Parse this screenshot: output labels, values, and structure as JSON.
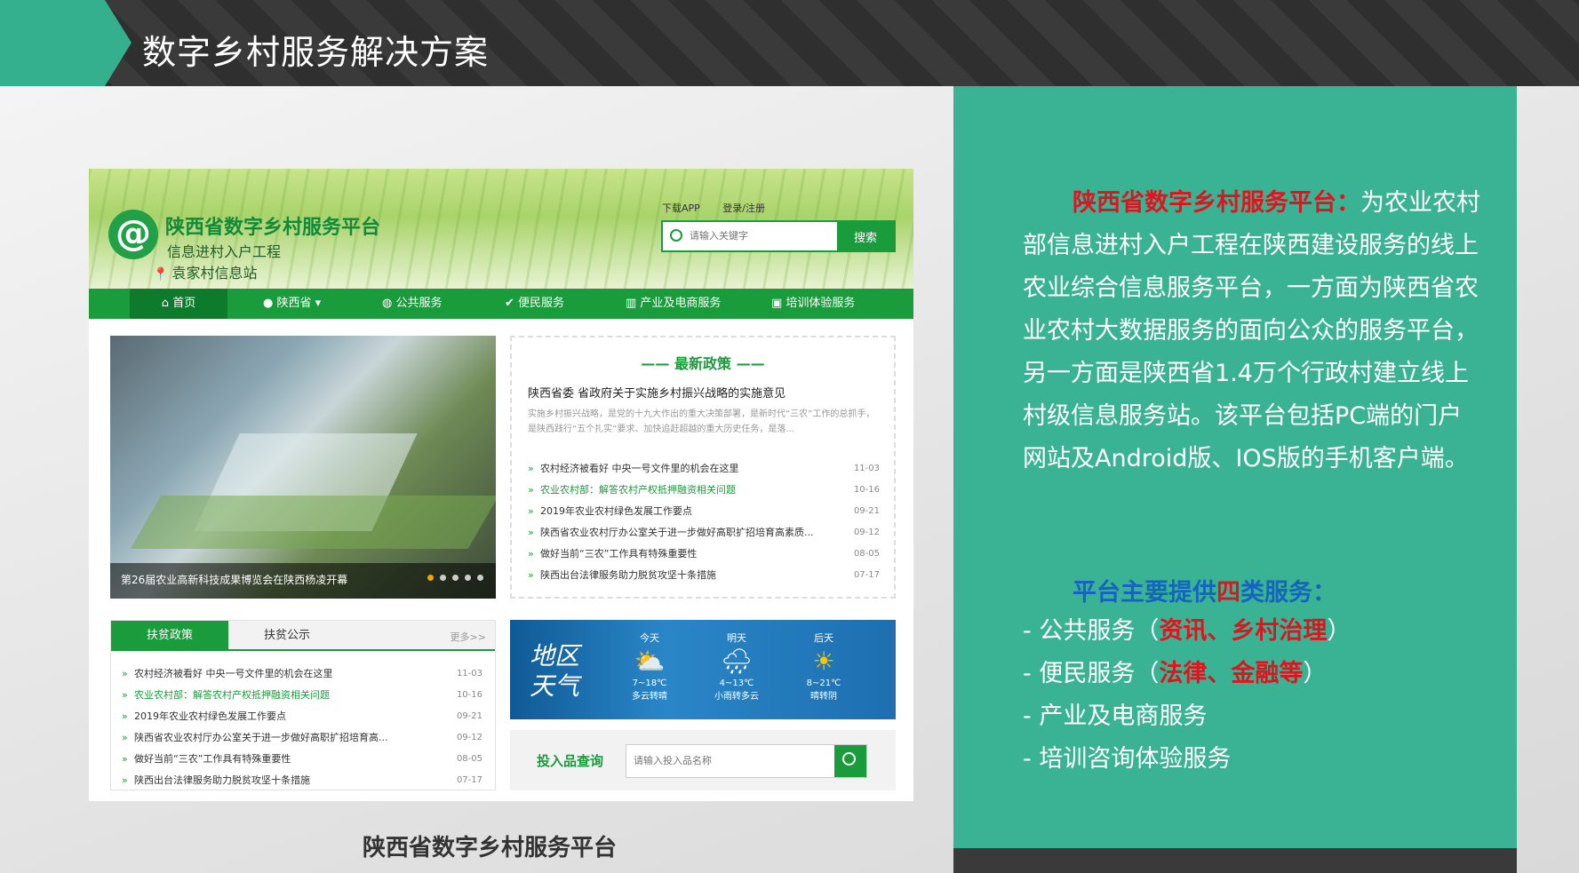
{
  "slide": {
    "title": "数字乡村服务解决方案",
    "screenshot_caption": "陕西省数字乡村服务平台"
  },
  "site": {
    "logo_glyph": "@",
    "name": "陕西省数字乡村服务平台",
    "subtitle": "信息进村入户工程",
    "station": "袁家村信息站",
    "top_links": {
      "download_app": "下载APP",
      "login": "登录/注册"
    },
    "search": {
      "placeholder": "请输入关键字",
      "button": "搜索"
    },
    "nav": [
      "首页",
      "陕西省",
      "公共服务",
      "便民服务",
      "产业及电商服务",
      "培训体验服务"
    ],
    "carousel": {
      "caption": "第26届农业高新科技成果博览会在陕西杨凌开幕",
      "slides": 5,
      "active_slide": 1
    },
    "policy": {
      "title": "最新政策",
      "headline": "陕西省委 省政府关于实施乡村振兴战略的实施意见",
      "summary": "实施乡村振兴战略，是党的十九大作出的重大决策部署，是新时代“三农”工作的总抓手，是陕西践行“五个扎实”要求、加快追赶超越的重大历史任务，是落...",
      "items": [
        {
          "title": "农村经济被看好 中央一号文件里的机会在这里",
          "date": "11-03",
          "highlight": false
        },
        {
          "title": "农业农村部：解答农村产权抵押融资相关问题",
          "date": "10-16",
          "highlight": true
        },
        {
          "title": "2019年农业农村绿色发展工作要点",
          "date": "09-21",
          "highlight": false
        },
        {
          "title": "陕西省农业农村厅办公室关于进一步做好高职扩招培育高素质...",
          "date": "09-12",
          "highlight": false
        },
        {
          "title": "做好当前“三农”工作具有特殊重要性",
          "date": "08-05",
          "highlight": false
        },
        {
          "title": "陕西出台法律服务助力脱贫攻坚十条措施",
          "date": "07-17",
          "highlight": false
        }
      ]
    },
    "poverty": {
      "tabs": [
        "扶贫政策",
        "扶贫公示"
      ],
      "more": "更多>>",
      "items": [
        {
          "title": "农村经济被看好 中央一号文件里的机会在这里",
          "date": "11-03",
          "highlight": false
        },
        {
          "title": "农业农村部：解答农村产权抵押融资相关问题",
          "date": "10-16",
          "highlight": true
        },
        {
          "title": "2019年农业农村绿色发展工作要点",
          "date": "09-21",
          "highlight": false
        },
        {
          "title": "陕西省农业农村厅办公室关于进一步做好高职扩招培育高...",
          "date": "09-12",
          "highlight": false
        },
        {
          "title": "做好当前“三农”工作具有特殊重要性",
          "date": "08-05",
          "highlight": false
        },
        {
          "title": "陕西出台法律服务助力脱贫攻坚十条措施",
          "date": "07-17",
          "highlight": false
        }
      ]
    },
    "weather": {
      "title": "地区天气",
      "days": [
        {
          "label": "今天",
          "icon": "⛅",
          "temp": "7~18℃",
          "desc": "多云转晴"
        },
        {
          "label": "明天",
          "icon": "🌧",
          "temp": "4~13℃",
          "desc": "小雨转多云"
        },
        {
          "label": "后天",
          "icon": "☀",
          "temp": "8~21℃",
          "desc": "晴转阴"
        }
      ]
    },
    "input_lookup": {
      "label": "投入品查询",
      "placeholder": "请输入投入品名称"
    }
  },
  "panel": {
    "intro_title": "陕西省数字乡村服务平台：",
    "intro_body": "为农业农村部信息进村入户工程在陕西建设服务的线上农业综合信息服务平台，一方面为陕西省农业农村大数据服务的面向公众的服务平台，另一方面是陕西省1.4万个行政村建立线上村级信息服务站。该平台包括PC端的门户网站及Android版、IOS版的手机客户端。",
    "services_heading_pre": "平台主要提供",
    "services_heading_num": "四",
    "services_heading_post": "类服务：",
    "services": [
      {
        "name": "- 公共服务",
        "open": "（",
        "detail": "资讯、乡村治理",
        "close": "）"
      },
      {
        "name": "- 便民服务",
        "open": "（",
        "detail": "法律、金融等",
        "close": "）"
      },
      {
        "name": "- 产业及电商服务",
        "open": "",
        "detail": "",
        "close": ""
      },
      {
        "name": "- 培训咨询体验服务",
        "open": "",
        "detail": "",
        "close": ""
      }
    ]
  },
  "colors": {
    "accent_green": "#1a9b3c",
    "panel_teal": "#3ab394",
    "highlight_red": "#e0141e",
    "heading_blue": "#1565c0"
  }
}
